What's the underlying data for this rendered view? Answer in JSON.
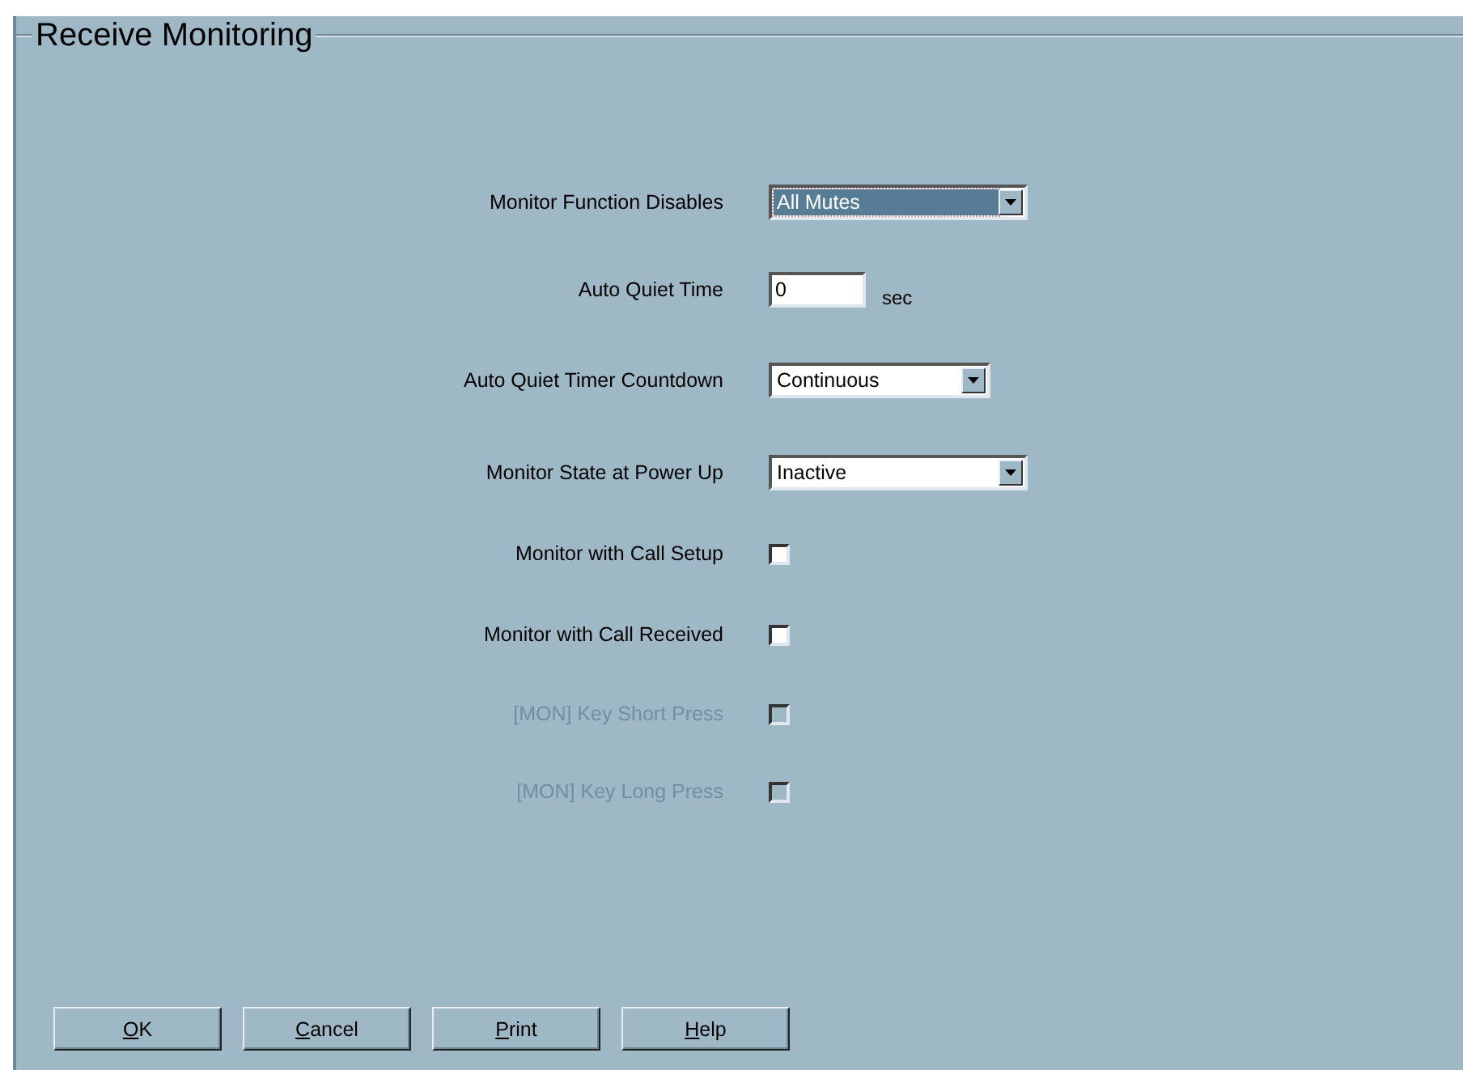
{
  "group": {
    "title": "Receive Monitoring"
  },
  "fields": [
    {
      "kind": "dropdown",
      "label": "Monitor Function Disables",
      "value": "All Mutes",
      "focused": true,
      "disabled": false
    },
    {
      "kind": "number",
      "label": "Auto Quiet Time",
      "value": "0",
      "unit": "sec",
      "disabled": false
    },
    {
      "kind": "dropdown",
      "label": "Auto Quiet Timer Countdown",
      "value": "Continuous",
      "focused": false,
      "disabled": false
    },
    {
      "kind": "dropdown",
      "label": "Monitor State at Power Up",
      "value": "Inactive",
      "focused": false,
      "disabled": false
    },
    {
      "kind": "checkbox",
      "label": "Monitor with Call Setup",
      "checked": false,
      "disabled": false
    },
    {
      "kind": "checkbox",
      "label": "Monitor with Call Received",
      "checked": false,
      "disabled": false
    },
    {
      "kind": "checkbox",
      "label": "[MON] Key Short Press",
      "checked": false,
      "disabled": true
    },
    {
      "kind": "checkbox",
      "label": "[MON] Key Long Press",
      "checked": false,
      "disabled": true
    }
  ],
  "buttons": [
    {
      "label": "OK",
      "underline_first": true
    },
    {
      "label": "Cancel",
      "underline_first": true
    },
    {
      "label": "Print",
      "underline_first": true
    },
    {
      "label": "Help",
      "underline_first": true
    }
  ]
}
